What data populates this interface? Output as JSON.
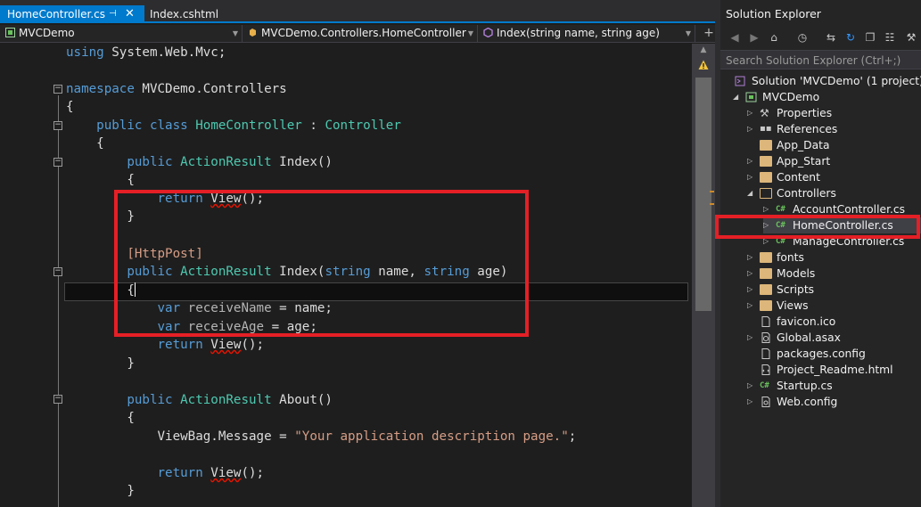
{
  "tabs": [
    {
      "label": "HomeController.cs",
      "active": true
    },
    {
      "label": "Index.cshtml",
      "active": false
    }
  ],
  "tab_icons": {
    "pin": "pin-icon",
    "close": "close-icon"
  },
  "navbar": {
    "project": "MVCDemo",
    "class": "MVCDemo.Controllers.HomeController",
    "member": "Index(string name, string age)"
  },
  "code": {
    "l1": {
      "kw": "using",
      "rest": " System.Web.Mvc;"
    },
    "l3": {
      "kw": "namespace",
      "rest": " MVCDemo.Controllers"
    },
    "l4": "{",
    "l5": {
      "kw1": "public",
      "kw2": "class",
      "name": "HomeController",
      "colon": " : ",
      "base": "Controller"
    },
    "l6": "{",
    "l7": {
      "kw": "public",
      "type": "ActionResult",
      "rest": " Index()"
    },
    "l8": "{",
    "l9": {
      "kw": "return",
      "call": "View",
      "rest": "();"
    },
    "l10": "}",
    "l12": {
      "attr": "[HttpPost]"
    },
    "l13": {
      "kw": "public",
      "type": "ActionResult",
      "name": " Index(",
      "t1": "string",
      "p1": " name, ",
      "t2": "string",
      "p2": " age)"
    },
    "l14": "{",
    "l15": {
      "kw": "var",
      "name": " receiveName",
      "rest": " = name;"
    },
    "l16": {
      "kw": "var",
      "name": " receiveAge",
      "rest": " = age;"
    },
    "l17": {
      "kw": "return",
      "call": "View",
      "rest": "();"
    },
    "l18": "}",
    "l20": {
      "kw": "public",
      "type": "ActionResult",
      "rest": " About()"
    },
    "l21": "{",
    "l22": {
      "obj": "ViewBag.Message = ",
      "str": "\"Your application description page.\"",
      "end": ";"
    },
    "l24": {
      "kw": "return",
      "call": "View",
      "rest": "();"
    },
    "l25": "}"
  },
  "solution_explorer": {
    "title": "Solution Explorer",
    "search_placeholder": "Search Solution Explorer (Ctrl+;)",
    "toolbar_icons": [
      "back-icon",
      "forward-icon",
      "home-icon",
      "history-icon",
      "sync-icon",
      "refresh-icon",
      "collapse-icon",
      "show-files-icon",
      "properties-icon"
    ],
    "tree": [
      {
        "label": "Solution 'MVCDemo' (1 project)",
        "icon": "solution-icon"
      },
      {
        "label": "MVCDemo",
        "icon": "project-icon"
      },
      {
        "label": "Properties",
        "icon": "wrench-icon"
      },
      {
        "label": "References",
        "icon": "references-icon"
      },
      {
        "label": "App_Data",
        "icon": "folder-icon"
      },
      {
        "label": "App_Start",
        "icon": "folder-icon"
      },
      {
        "label": "Content",
        "icon": "folder-icon"
      },
      {
        "label": "Controllers",
        "icon": "folder-icon"
      },
      {
        "label": "AccountController.cs",
        "icon": "csharp-icon"
      },
      {
        "label": "HomeController.cs",
        "icon": "csharp-icon",
        "selected": true
      },
      {
        "label": "ManageController.cs",
        "icon": "csharp-icon"
      },
      {
        "label": "fonts",
        "icon": "folder-icon"
      },
      {
        "label": "Models",
        "icon": "folder-icon"
      },
      {
        "label": "Scripts",
        "icon": "folder-icon"
      },
      {
        "label": "Views",
        "icon": "folder-icon"
      },
      {
        "label": "favicon.ico",
        "icon": "file-icon"
      },
      {
        "label": "Global.asax",
        "icon": "global-icon"
      },
      {
        "label": "packages.config",
        "icon": "config-icon"
      },
      {
        "label": "Project_Readme.html",
        "icon": "html-icon"
      },
      {
        "label": "Startup.cs",
        "icon": "csharp-icon"
      },
      {
        "label": "Web.config",
        "icon": "config-icon"
      }
    ]
  },
  "colors": {
    "accent": "#007acc",
    "highlight_box": "#e51f26",
    "keyword": "#569cd6",
    "type": "#4ec9b0",
    "string": "#d69d85"
  }
}
